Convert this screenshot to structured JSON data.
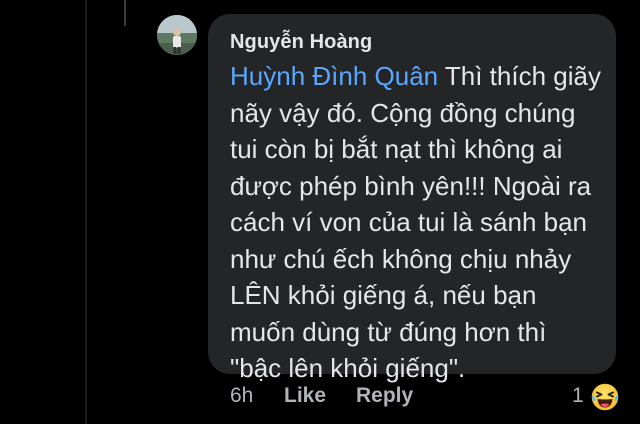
{
  "comment": {
    "author": "Nguyễn Hoàng",
    "mention": "Huỳnh Đình Quân",
    "first_line_rest": " Thì thích giãy",
    "lines": [
      "nãy vậy đó. Cộng đồng chúng",
      "tui còn bị bắt nạt thì không ai",
      "được phép bình yên!!! Ngoài ra",
      "cách ví von của tui là sánh bạn",
      "như chú ếch không chịu nhảy",
      "LÊN khỏi giếng á, nếu bạn",
      "muốn dùng từ đúng hơn thì",
      "\"bậc lên khỏi giếng\"."
    ]
  },
  "actions": {
    "time": "6h",
    "like_label": "Like",
    "reply_label": "Reply"
  },
  "reaction": {
    "count": "1",
    "icon": "laughing-emoji-icon"
  },
  "colors": {
    "background": "#000000",
    "bubble": "#242526",
    "text": "#e4e6eb",
    "secondary_text": "#b0b3b8",
    "mention": "#5aa7ff"
  }
}
